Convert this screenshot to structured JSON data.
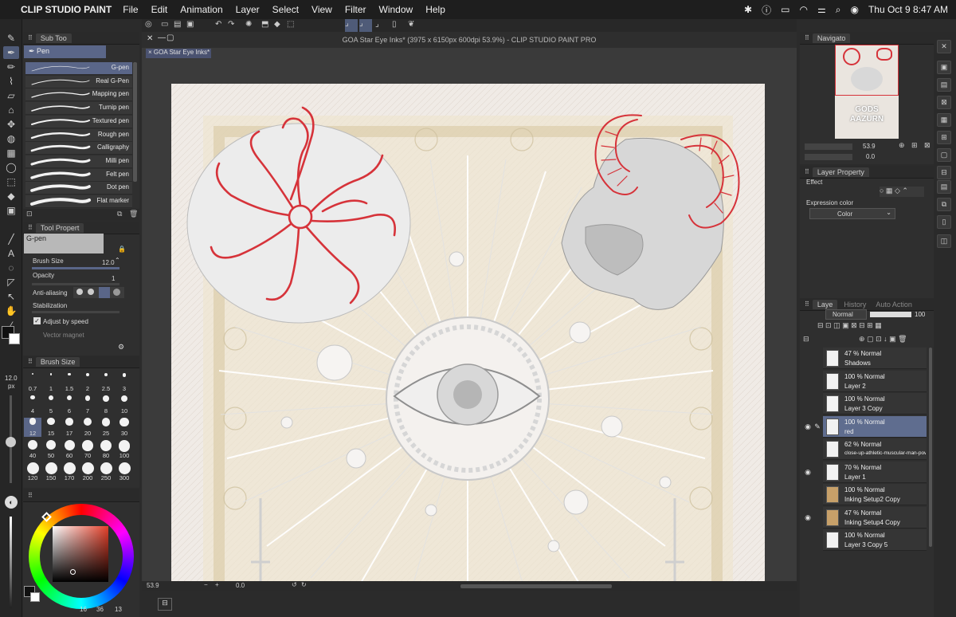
{
  "menubar": {
    "app_name": "CLIP STUDIO PAINT",
    "items": [
      "File",
      "Edit",
      "Animation",
      "Layer",
      "Select",
      "View",
      "Filter",
      "Window",
      "Help"
    ],
    "clock": "Thu Oct 9  8:47 AM"
  },
  "window": {
    "title": "GOA Star Eye Inks* (3975 x 6150px 600dpi 53.9%)  - CLIP STUDIO PAINT PRO",
    "doc_tab": "GOA Star Eye Inks*"
  },
  "subtool": {
    "header": "Sub Too",
    "group": "Pen",
    "active": "G-pen",
    "brushes": [
      "G-pen",
      "Real G-Pen",
      "Mapping pen",
      "Turnip pen",
      "Textured pen",
      "Rough pen",
      "Calligraphy",
      "Milli pen",
      "Felt pen",
      "Dot pen",
      "Flat marker"
    ]
  },
  "tool_property": {
    "header": "Tool Propert",
    "tool_name": "G-pen",
    "brush_size_label": "Brush Size",
    "brush_size_value": "12.0",
    "opacity_label": "Opacity",
    "opacity_value": "1",
    "anti_aliasing_label": "Anti-aliasing",
    "stabilization_label": "Stabilization",
    "adjust_label": "Adjust by speed",
    "vector_magnet_label": "Vector magnet"
  },
  "brush_size_panel": {
    "header": "Brush Size",
    "current": "12.0",
    "unit": "px",
    "sizes": [
      "0.7",
      "1",
      "1.5",
      "2",
      "2.5",
      "3",
      "4",
      "5",
      "6",
      "7",
      "8",
      "10",
      "12",
      "15",
      "17",
      "20",
      "25",
      "30",
      "40",
      "50",
      "60",
      "70",
      "80",
      "100",
      "120",
      "150",
      "170",
      "200",
      "250",
      "300"
    ]
  },
  "color_wheel": {
    "hue_color": "#e4402a",
    "footer_values": [
      "16",
      "36",
      "13"
    ]
  },
  "status": {
    "zoom": "53.9",
    "angle": "0.0"
  },
  "navigator": {
    "header": "Navigato",
    "zoom": "53.9",
    "angle": "0.0",
    "thumb_title_1": "GODS",
    "thumb_title_2": "AAZURN"
  },
  "layer_property": {
    "header": "Layer Property",
    "effect_label": "Effect",
    "expression_label": "Expression color",
    "expression_value": "Color"
  },
  "layer_panel": {
    "tabs": [
      "Laye",
      "History",
      "Auto Action"
    ],
    "blend_mode": "Normal",
    "opacity": "100",
    "layers": [
      {
        "opacity": "47 %",
        "mode": "Normal",
        "name": "Shadows"
      },
      {
        "opacity": "100 %",
        "mode": "Normal",
        "name": "Layer 2"
      },
      {
        "opacity": "100 %",
        "mode": "Normal",
        "name": "Layer 3 Copy"
      },
      {
        "opacity": "100 %",
        "mode": "Normal",
        "name": "red"
      },
      {
        "opacity": "62 %",
        "mode": "Normal",
        "name": "close-up-athletic-muscular-man-powe"
      },
      {
        "opacity": "70 %",
        "mode": "Normal",
        "name": "Layer 1"
      },
      {
        "opacity": "100 %",
        "mode": "Normal",
        "name": "Inking Setup2 Copy"
      },
      {
        "opacity": "47 %",
        "mode": "Normal",
        "name": "Inking Setup4 Copy"
      },
      {
        "opacity": "100 %",
        "mode": "Normal",
        "name": "Layer 3 Copy 5"
      }
    ]
  },
  "colors": {
    "accent": "#5a6688",
    "ink_red": "#d6333a"
  }
}
